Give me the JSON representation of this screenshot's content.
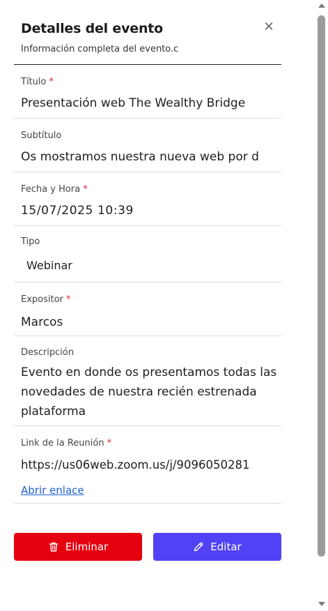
{
  "dialog": {
    "title": "Detalles del evento",
    "subtitle": "Información completa del evento.c"
  },
  "fields": {
    "titulo": {
      "label": "Título",
      "required_mark": "*",
      "value": "Presentación web The Wealthy Bridge"
    },
    "subtitulo": {
      "label": "Subtítulo",
      "value": "Os mostramos nuestra nueva web por d"
    },
    "fecha": {
      "label": "Fecha y Hora",
      "required_mark": "*",
      "value": "15/07/2025 10:39"
    },
    "tipo": {
      "label": "Tipo",
      "value": "Webinar"
    },
    "expositor": {
      "label": "Expositor",
      "required_mark": "*",
      "value": "Marcos"
    },
    "descripcion": {
      "label": "Descripción",
      "value": "Evento en donde os presentamos todas las novedades de nuestra recién estrenada plataforma"
    },
    "link": {
      "label": "Link de la Reunión",
      "required_mark": "*",
      "value": "https://us06web.zoom.us/j/9096050281",
      "open_label": "Abrir enlace"
    }
  },
  "buttons": {
    "delete_label": "Eliminar",
    "edit_label": "Editar"
  },
  "colors": {
    "delete": "#e5000f",
    "edit": "#5143f5",
    "required": "#e0203a",
    "link": "#1f5fd1"
  },
  "icons": [
    "close-icon",
    "trash-icon",
    "pencil-icon"
  ]
}
